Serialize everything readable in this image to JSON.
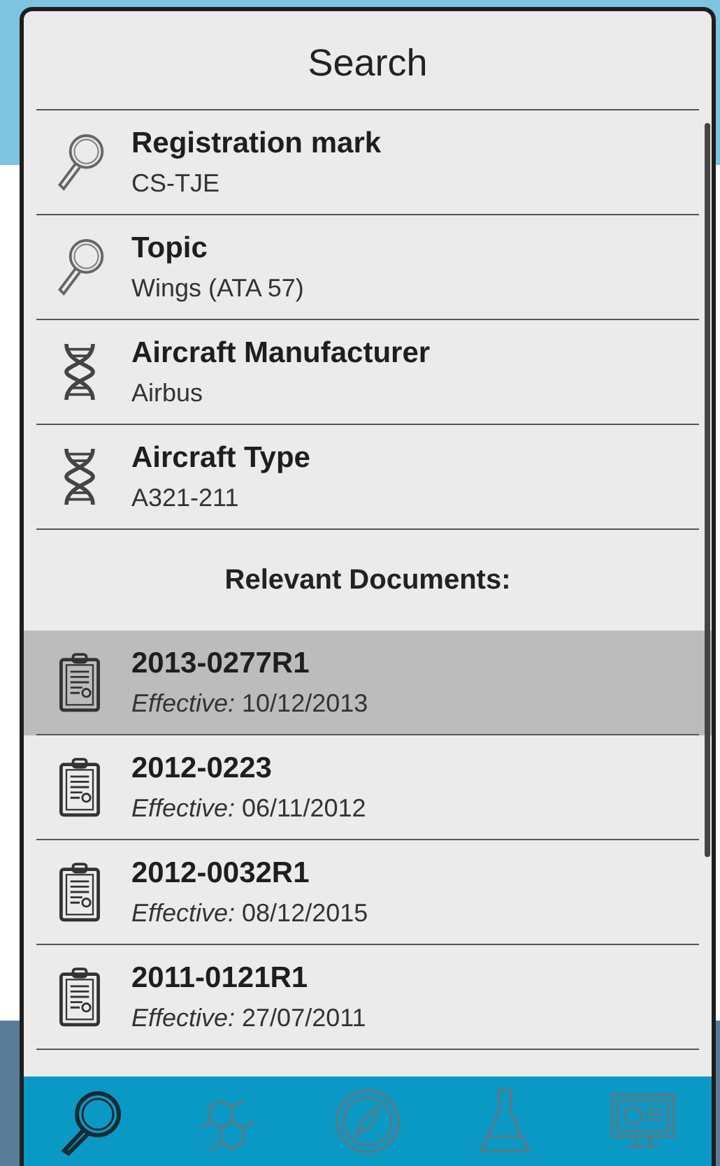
{
  "title": "Search",
  "filters": [
    {
      "kind": "search",
      "label": "Registration mark",
      "value": "CS-TJE"
    },
    {
      "kind": "search",
      "label": "Topic",
      "value": "Wings (ATA 57)"
    },
    {
      "kind": "dna",
      "label": "Aircraft Manufacturer",
      "value": "Airbus"
    },
    {
      "kind": "dna",
      "label": "Aircraft Type",
      "value": "A321-211"
    }
  ],
  "documents_heading": "Relevant Documents:",
  "documents": [
    {
      "id": "2013-0277R1",
      "effective_label": "Effective:",
      "date": "10/12/2013",
      "selected": true
    },
    {
      "id": "2012-0223",
      "effective_label": "Effective:",
      "date": "06/11/2012",
      "selected": false
    },
    {
      "id": "2012-0032R1",
      "effective_label": "Effective:",
      "date": "08/12/2015",
      "selected": false
    },
    {
      "id": "2011-0121R1",
      "effective_label": "Effective:",
      "date": "27/07/2011",
      "selected": false
    }
  ],
  "tabs": [
    {
      "kind": "search",
      "selected": true
    },
    {
      "kind": "molecule",
      "selected": false
    },
    {
      "kind": "compass",
      "selected": false
    },
    {
      "kind": "flask",
      "selected": false
    },
    {
      "kind": "monitor",
      "selected": false
    }
  ]
}
